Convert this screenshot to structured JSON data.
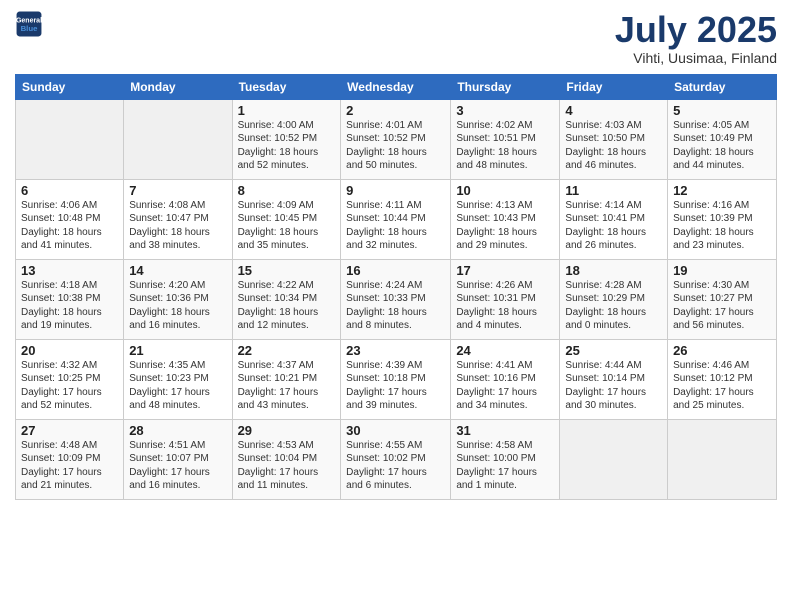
{
  "header": {
    "logo_line1": "General",
    "logo_line2": "Blue",
    "month": "July 2025",
    "location": "Vihti, Uusimaa, Finland"
  },
  "days_of_week": [
    "Sunday",
    "Monday",
    "Tuesday",
    "Wednesday",
    "Thursday",
    "Friday",
    "Saturday"
  ],
  "weeks": [
    [
      {
        "day": "",
        "info": ""
      },
      {
        "day": "",
        "info": ""
      },
      {
        "day": "1",
        "info": "Sunrise: 4:00 AM\nSunset: 10:52 PM\nDaylight: 18 hours and 52 minutes."
      },
      {
        "day": "2",
        "info": "Sunrise: 4:01 AM\nSunset: 10:52 PM\nDaylight: 18 hours and 50 minutes."
      },
      {
        "day": "3",
        "info": "Sunrise: 4:02 AM\nSunset: 10:51 PM\nDaylight: 18 hours and 48 minutes."
      },
      {
        "day": "4",
        "info": "Sunrise: 4:03 AM\nSunset: 10:50 PM\nDaylight: 18 hours and 46 minutes."
      },
      {
        "day": "5",
        "info": "Sunrise: 4:05 AM\nSunset: 10:49 PM\nDaylight: 18 hours and 44 minutes."
      }
    ],
    [
      {
        "day": "6",
        "info": "Sunrise: 4:06 AM\nSunset: 10:48 PM\nDaylight: 18 hours and 41 minutes."
      },
      {
        "day": "7",
        "info": "Sunrise: 4:08 AM\nSunset: 10:47 PM\nDaylight: 18 hours and 38 minutes."
      },
      {
        "day": "8",
        "info": "Sunrise: 4:09 AM\nSunset: 10:45 PM\nDaylight: 18 hours and 35 minutes."
      },
      {
        "day": "9",
        "info": "Sunrise: 4:11 AM\nSunset: 10:44 PM\nDaylight: 18 hours and 32 minutes."
      },
      {
        "day": "10",
        "info": "Sunrise: 4:13 AM\nSunset: 10:43 PM\nDaylight: 18 hours and 29 minutes."
      },
      {
        "day": "11",
        "info": "Sunrise: 4:14 AM\nSunset: 10:41 PM\nDaylight: 18 hours and 26 minutes."
      },
      {
        "day": "12",
        "info": "Sunrise: 4:16 AM\nSunset: 10:39 PM\nDaylight: 18 hours and 23 minutes."
      }
    ],
    [
      {
        "day": "13",
        "info": "Sunrise: 4:18 AM\nSunset: 10:38 PM\nDaylight: 18 hours and 19 minutes."
      },
      {
        "day": "14",
        "info": "Sunrise: 4:20 AM\nSunset: 10:36 PM\nDaylight: 18 hours and 16 minutes."
      },
      {
        "day": "15",
        "info": "Sunrise: 4:22 AM\nSunset: 10:34 PM\nDaylight: 18 hours and 12 minutes."
      },
      {
        "day": "16",
        "info": "Sunrise: 4:24 AM\nSunset: 10:33 PM\nDaylight: 18 hours and 8 minutes."
      },
      {
        "day": "17",
        "info": "Sunrise: 4:26 AM\nSunset: 10:31 PM\nDaylight: 18 hours and 4 minutes."
      },
      {
        "day": "18",
        "info": "Sunrise: 4:28 AM\nSunset: 10:29 PM\nDaylight: 18 hours and 0 minutes."
      },
      {
        "day": "19",
        "info": "Sunrise: 4:30 AM\nSunset: 10:27 PM\nDaylight: 17 hours and 56 minutes."
      }
    ],
    [
      {
        "day": "20",
        "info": "Sunrise: 4:32 AM\nSunset: 10:25 PM\nDaylight: 17 hours and 52 minutes."
      },
      {
        "day": "21",
        "info": "Sunrise: 4:35 AM\nSunset: 10:23 PM\nDaylight: 17 hours and 48 minutes."
      },
      {
        "day": "22",
        "info": "Sunrise: 4:37 AM\nSunset: 10:21 PM\nDaylight: 17 hours and 43 minutes."
      },
      {
        "day": "23",
        "info": "Sunrise: 4:39 AM\nSunset: 10:18 PM\nDaylight: 17 hours and 39 minutes."
      },
      {
        "day": "24",
        "info": "Sunrise: 4:41 AM\nSunset: 10:16 PM\nDaylight: 17 hours and 34 minutes."
      },
      {
        "day": "25",
        "info": "Sunrise: 4:44 AM\nSunset: 10:14 PM\nDaylight: 17 hours and 30 minutes."
      },
      {
        "day": "26",
        "info": "Sunrise: 4:46 AM\nSunset: 10:12 PM\nDaylight: 17 hours and 25 minutes."
      }
    ],
    [
      {
        "day": "27",
        "info": "Sunrise: 4:48 AM\nSunset: 10:09 PM\nDaylight: 17 hours and 21 minutes."
      },
      {
        "day": "28",
        "info": "Sunrise: 4:51 AM\nSunset: 10:07 PM\nDaylight: 17 hours and 16 minutes."
      },
      {
        "day": "29",
        "info": "Sunrise: 4:53 AM\nSunset: 10:04 PM\nDaylight: 17 hours and 11 minutes."
      },
      {
        "day": "30",
        "info": "Sunrise: 4:55 AM\nSunset: 10:02 PM\nDaylight: 17 hours and 6 minutes."
      },
      {
        "day": "31",
        "info": "Sunrise: 4:58 AM\nSunset: 10:00 PM\nDaylight: 17 hours and 1 minute."
      },
      {
        "day": "",
        "info": ""
      },
      {
        "day": "",
        "info": ""
      }
    ]
  ]
}
